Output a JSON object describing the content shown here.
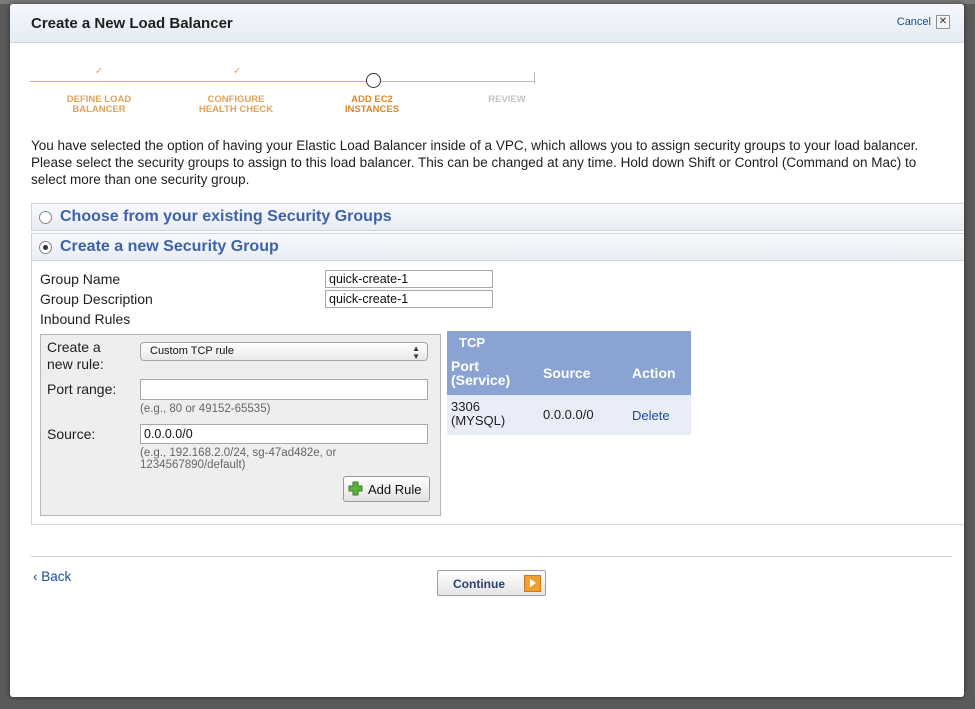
{
  "dialog": {
    "title": "Create a New Load Balancer",
    "cancel_label": "Cancel",
    "close_glyph": "✕"
  },
  "wizard": {
    "steps": [
      {
        "line1": "DEFINE LOAD",
        "line2": "BALANCER",
        "state": "done"
      },
      {
        "line1": "CONFIGURE",
        "line2": "HEALTH CHECK",
        "state": "done"
      },
      {
        "line1": "ADD EC2",
        "line2": "INSTANCES",
        "state": "current"
      },
      {
        "line1": "REVIEW",
        "line2": "",
        "state": "todo"
      }
    ],
    "check_glyph": "✓"
  },
  "intro_text": "You have selected the option of having your Elastic Load Balancer inside of a VPC, which allows you to assign security groups to your load balancer. Please select the security groups to assign to this load balancer. This can be changed at any time. Hold down Shift or Control (Command on Mac) to select more than one security group.",
  "options": {
    "existing_label": "Choose from your existing Security Groups",
    "new_label": "Create a new Security Group",
    "selected": "new"
  },
  "form": {
    "group_name_label": "Group Name",
    "group_name_value": "quick-create-1",
    "group_desc_label": "Group Description",
    "group_desc_value": "quick-create-1",
    "inbound_label": "Inbound Rules"
  },
  "rule_builder": {
    "create_label_1": "Create a",
    "create_label_2": "new rule:",
    "rule_type_value": "Custom TCP rule",
    "port_range_label": "Port range:",
    "port_range_value": "",
    "port_hint": "(e.g., 80 or 49152-65535)",
    "source_label": "Source:",
    "source_value": "0.0.0.0/0",
    "source_hint_1": "(e.g., 192.168.2.0/24, sg-47ad482e, or",
    "source_hint_2": "1234567890/default)",
    "add_rule_label": "Add Rule"
  },
  "tcp_table": {
    "title": "TCP",
    "col_port_1": "Port",
    "col_port_2": "(Service)",
    "col_source": "Source",
    "col_action": "Action",
    "rows": [
      {
        "port_1": "3306",
        "port_2": "(MYSQL)",
        "source": "0.0.0.0/0",
        "action": "Delete"
      }
    ]
  },
  "footer": {
    "back_label": "‹ Back",
    "continue_label": "Continue"
  },
  "colors": {
    "accent": "#3f62a8",
    "wizard_done": "#e0a35a",
    "table_header": "#8aa3d3",
    "link": "#1a4b99"
  }
}
